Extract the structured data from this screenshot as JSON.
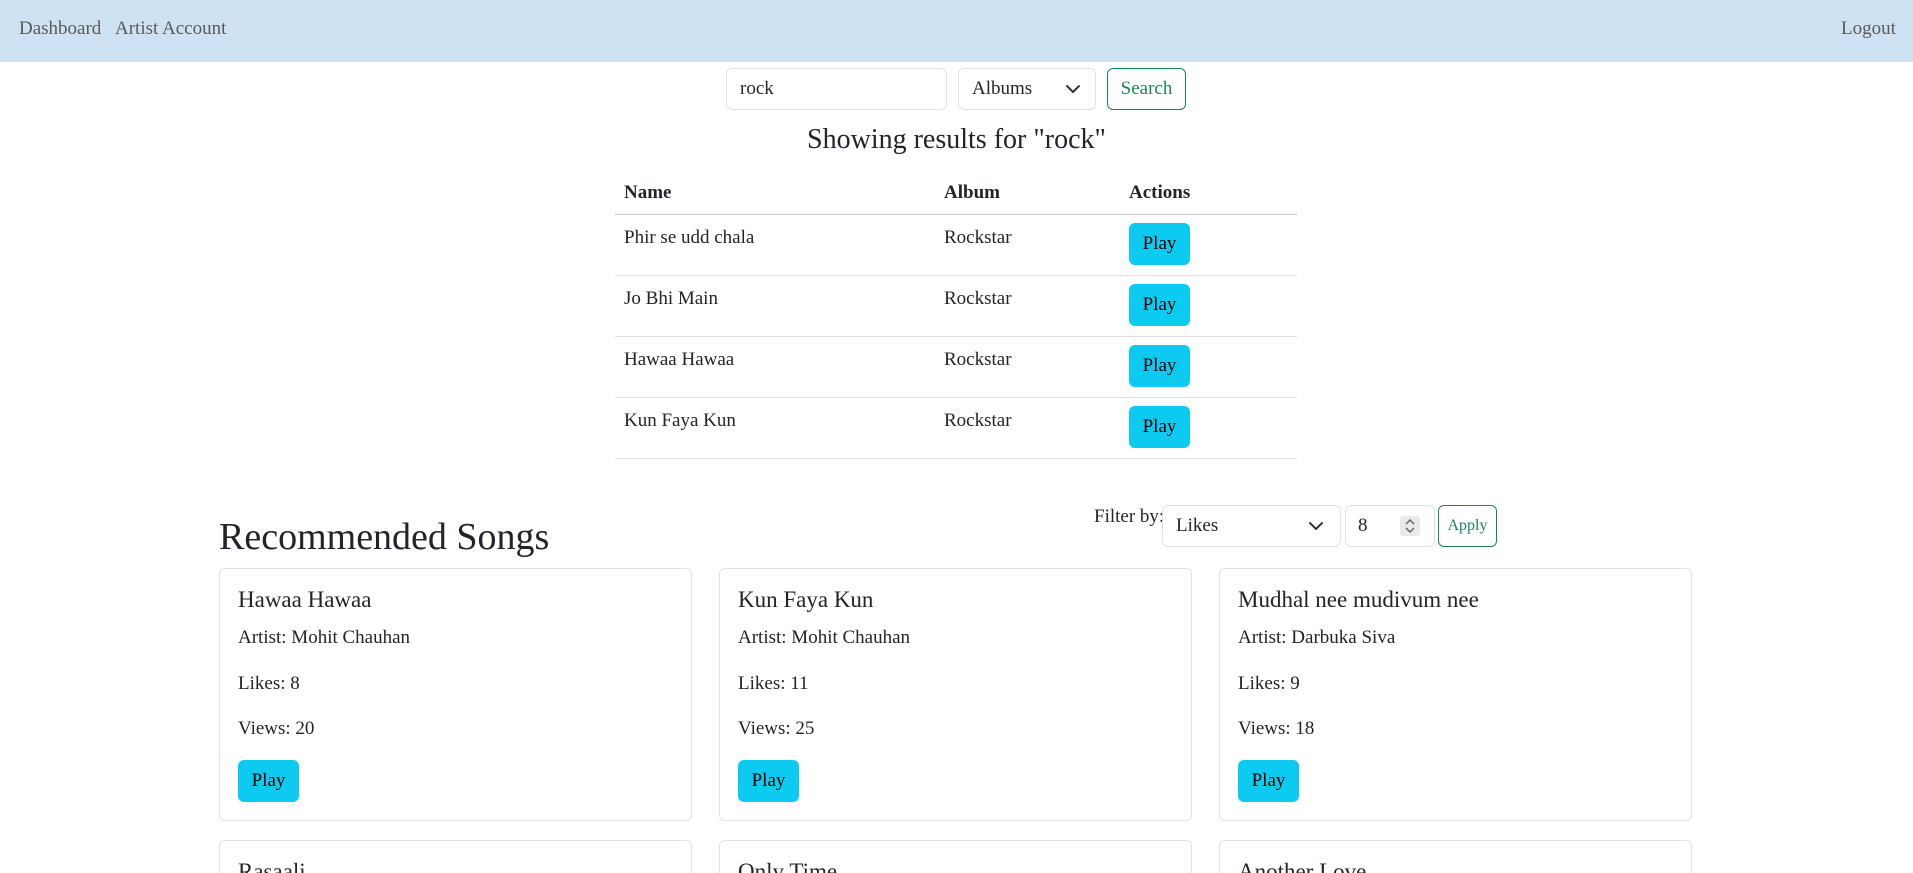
{
  "nav": {
    "dashboard": "Dashboard",
    "artist_account": "Artist Account",
    "logout": "Logout"
  },
  "search": {
    "query": "rock",
    "category": "Albums",
    "button": "Search"
  },
  "results": {
    "title": "Showing results for \"rock\"",
    "headers": {
      "name": "Name",
      "album": "Album",
      "actions": "Actions"
    },
    "rows": [
      {
        "name": "Phir se udd chala",
        "album": "Rockstar",
        "action": "Play"
      },
      {
        "name": "Jo Bhi Main",
        "album": "Rockstar",
        "action": "Play"
      },
      {
        "name": "Hawaa Hawaa",
        "album": "Rockstar",
        "action": "Play"
      },
      {
        "name": "Kun Faya Kun",
        "album": "Rockstar",
        "action": "Play"
      }
    ]
  },
  "recommended": {
    "title": "Recommended Songs",
    "filter_label": "Filter by:",
    "filter_field": "Likes",
    "filter_value": "8",
    "apply": "Apply",
    "cards": [
      {
        "title": "Hawaa Hawaa",
        "artist": "Artist: Mohit Chauhan",
        "likes": "Likes: 8",
        "views": "Views: 20",
        "play": "Play"
      },
      {
        "title": "Kun Faya Kun",
        "artist": "Artist: Mohit Chauhan",
        "likes": "Likes: 11",
        "views": "Views: 25",
        "play": "Play"
      },
      {
        "title": "Mudhal nee mudivum nee",
        "artist": "Artist: Darbuka Siva",
        "likes": "Likes: 9",
        "views": "Views: 18",
        "play": "Play"
      },
      {
        "title": "Rasaali"
      },
      {
        "title": "Only Time"
      },
      {
        "title": "Another Love"
      }
    ]
  },
  "colors": {
    "navbar_bg": "#cfe2f3",
    "play_button": "#0dcaf0",
    "outline_green": "#198754"
  }
}
